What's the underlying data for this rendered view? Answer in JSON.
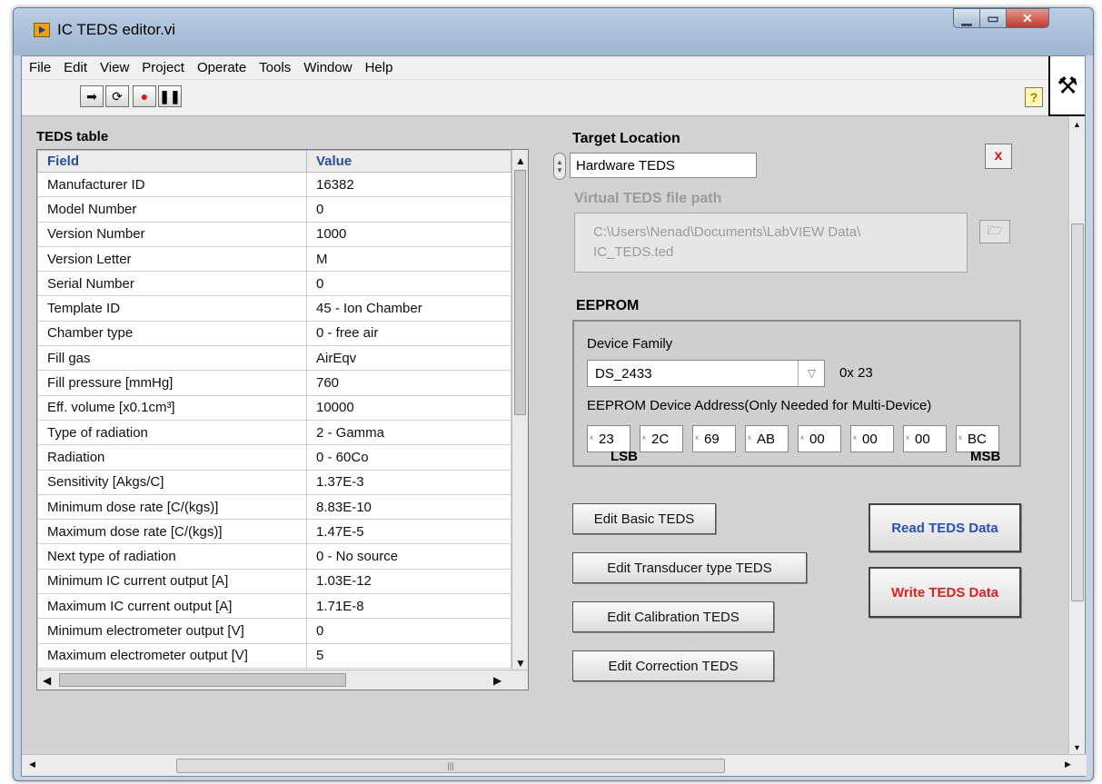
{
  "window": {
    "title": "IC TEDS editor.vi"
  },
  "menu": [
    "File",
    "Edit",
    "View",
    "Project",
    "Operate",
    "Tools",
    "Window",
    "Help"
  ],
  "teds_table": {
    "caption": "TEDS table",
    "columns": [
      "Field",
      "Value"
    ],
    "rows": [
      [
        "Manufacturer ID",
        "16382"
      ],
      [
        "Model Number",
        "0"
      ],
      [
        "Version Number",
        "1000"
      ],
      [
        "Version Letter",
        "M"
      ],
      [
        "Serial Number",
        "0"
      ],
      [
        "Template ID",
        "45 - Ion Chamber"
      ],
      [
        "Chamber type",
        "0 - free air"
      ],
      [
        "Fill gas",
        "AirEqv"
      ],
      [
        "Fill pressure [mmHg]",
        "760"
      ],
      [
        "Eff. volume [x0.1cm³]",
        "10000"
      ],
      [
        "Type of radiation",
        "2 - Gamma"
      ],
      [
        "Radiation",
        "0 - 60Co"
      ],
      [
        "Sensitivity [Akgs/C]",
        "1.37E-3"
      ],
      [
        "Minimum dose rate [C/(kgs)]",
        "8.83E-10"
      ],
      [
        "Maximum dose rate [C/(kgs)]",
        "1.47E-5"
      ],
      [
        "Next type of radiation",
        "0 - No source"
      ],
      [
        "Minimum IC current output [A]",
        "1.03E-12"
      ],
      [
        "Maximum IC current output [A]",
        "1.71E-8"
      ],
      [
        "Minimum electrometer output [V]",
        "0"
      ],
      [
        "Maximum electrometer output [V]",
        "5"
      ]
    ]
  },
  "target_location": {
    "label": "Target Location",
    "value": "Hardware TEDS"
  },
  "virtual_teds": {
    "label": "Virtual TEDS file path",
    "path_line1": "C:\\Users\\Nenad\\Documents\\LabVIEW Data\\",
    "path_line2": "IC_TEDS.ted"
  },
  "eeprom": {
    "label": "EEPROM",
    "device_family_label": "Device Family",
    "device_family_value": "DS_2433",
    "device_family_code": "0x 23",
    "address_label": "EEPROM Device Address(Only Needed for Multi-Device)",
    "address_bytes": [
      "23",
      "2C",
      "69",
      "AB",
      "00",
      "00",
      "00",
      "BC"
    ],
    "lsb_label": "LSB",
    "msb_label": "MSB"
  },
  "buttons": {
    "edit_basic": "Edit Basic TEDS",
    "edit_transducer": "Edit Transducer type TEDS",
    "edit_calibration": "Edit Calibration  TEDS",
    "edit_correction": "Edit Correction  TEDS",
    "read": "Read TEDS Data",
    "write": "Write TEDS Data",
    "close": "x"
  },
  "colors": {
    "read_button_text": "#2a4fb5",
    "write_button_text": "#e02020",
    "table_header_text": "#2a4d9a"
  }
}
